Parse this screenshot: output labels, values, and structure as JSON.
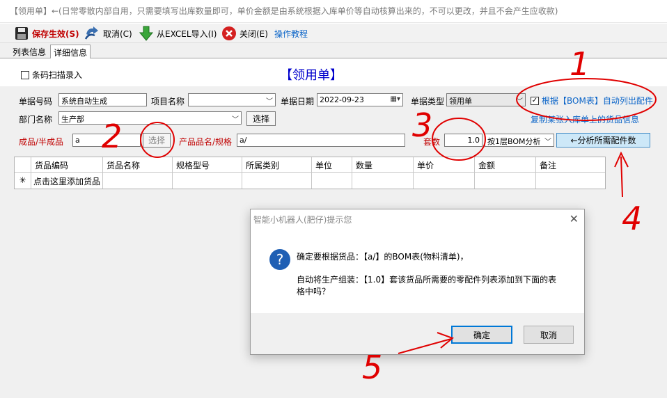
{
  "window": {
    "title": "【领用单】←(日常零散内部自用，只需要填写出库数量即可，单价金额是由系统根据入库单价等自动核算出来的，不可以更改，并且不会产生应收款)"
  },
  "toolbar": {
    "save": "保存生效(S)",
    "cancel": "取消(C)",
    "excel": "从EXCEL导入(I)",
    "close": "关闭(E)",
    "tutorial": "操作教程"
  },
  "tabs": [
    "列表信息",
    "详细信息"
  ],
  "form": {
    "barcode_label": "条码扫描录入",
    "heading": "【领用单】",
    "doc_no_label": "单据号码",
    "doc_no_value": "系统自动生成",
    "project_label": "项目名称",
    "project_value": "",
    "date_label": "单据日期",
    "date_value": "2022-09-23",
    "type_label": "单据类型",
    "type_value": "领用单",
    "bom_label": "根据【BOM表】自动列出配件",
    "copy_link": "复制某张入库单上的货品信息",
    "dept_label": "部门名称",
    "dept_value": "生产部",
    "dept_select": "选择",
    "product_label": "成品/半成品",
    "product_value": "a",
    "product_select": "选择",
    "product_name_label": "产品品名/规格",
    "product_name_value": "a/",
    "sets_label": "套数",
    "sets_value": "1.0",
    "bom_level": "按1层BOM分析",
    "analyze_button": "←分析所需配件数"
  },
  "grid": {
    "columns": [
      "货品编码",
      "货品名称",
      "规格型号",
      "所属类别",
      "单位",
      "数量",
      "单价",
      "金额",
      "备注"
    ],
    "new_row_marker": "✳",
    "add_row_text": "点击这里添加货品"
  },
  "dialog": {
    "title": "智能小机器人(肥仔)提示您",
    "line1": "确定要根据货品：【a/】的BOM表(物料清单)，",
    "line2": "自动将生产组装：【1.0】套该货品所需要的零配件列表添加到下面的表",
    "line3": "格中吗？",
    "ok": "确定",
    "cancel": "取消"
  },
  "annotations": [
    "1",
    "2",
    "3",
    "4",
    "5"
  ],
  "colors": {
    "accent_red": "#c00000",
    "heading_blue": "#0000cc",
    "link_blue": "#0a64c8",
    "annot_red": "#e00000",
    "analyze_bg": "#cde8f8"
  }
}
